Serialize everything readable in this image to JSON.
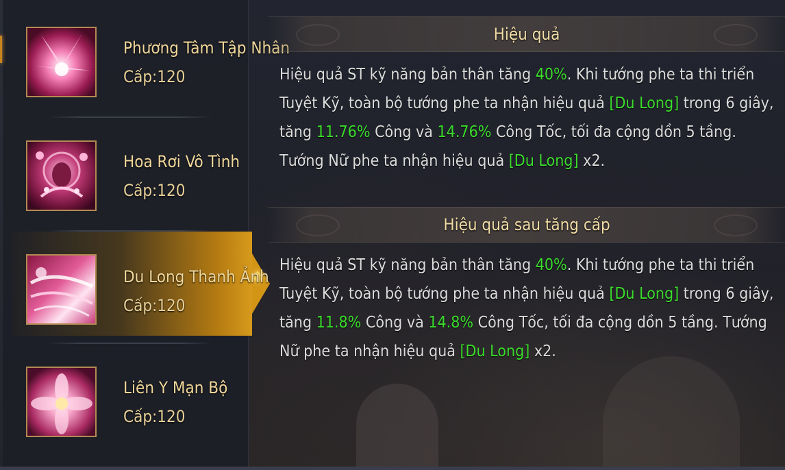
{
  "skills": [
    {
      "name": "Phương Tâm Tập Nhân",
      "level": "Cấp:120",
      "selected": false
    },
    {
      "name": "Hoa Rơi Vô Tình",
      "level": "Cấp:120",
      "selected": false
    },
    {
      "name": "Du Long Thanh Ảnh",
      "level": "Cấp:120",
      "selected": true
    },
    {
      "name": "Liên Y Mạn Bộ",
      "level": "Cấp:120",
      "selected": false
    }
  ],
  "effect": {
    "title": "Hiệu quả",
    "lines": [
      [
        "Hiệu quả ST kỹ năng bản thân tăng ",
        "40%",
        ". Khi tướng phe ta thi triển"
      ],
      [
        "Tuyệt Kỹ, toàn bộ tướng phe ta nhận hiệu quả ",
        "[Du Long]",
        " trong 6 giây,"
      ],
      [
        "tăng ",
        "11.76%",
        " Công và ",
        "14.76%",
        " Công Tốc, tối đa cộng dồn 5 tầng."
      ],
      [
        "Tướng Nữ phe ta nhận hiệu quả ",
        "[Du Long]",
        " x2."
      ]
    ]
  },
  "upgrade": {
    "title": "Hiệu quả sau tăng cấp",
    "lines": [
      [
        "Hiệu quả ST kỹ năng bản thân tăng ",
        "40%",
        ". Khi tướng phe ta thi triển"
      ],
      [
        "Tuyệt Kỹ, toàn bộ tướng phe ta nhận hiệu quả ",
        "[Du Long]",
        " trong 6 giây,"
      ],
      [
        "tăng ",
        "11.8%",
        " Công và ",
        "14.8%",
        " Công Tốc, tối đa cộng dồn 5 tầng. Tướng"
      ],
      [
        "Nữ phe ta nhận hiệu quả ",
        "[Du Long]",
        " x2."
      ]
    ]
  },
  "colors": {
    "highlight": "#3bdc2c",
    "title": "#f1dca6",
    "selected_accent": "#d79a1c"
  },
  "icons": [
    "lotus-burst-icon",
    "falling-flower-icon",
    "dragon-shadow-icon",
    "lotus-step-icon"
  ]
}
